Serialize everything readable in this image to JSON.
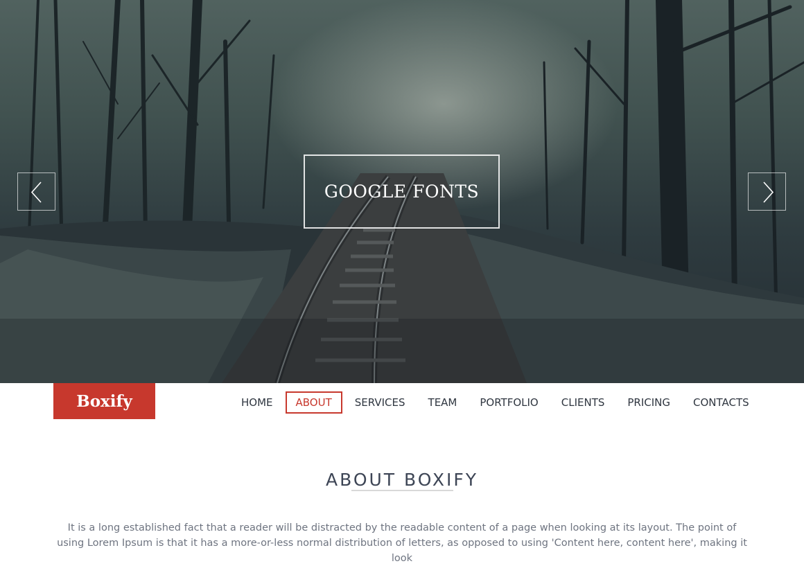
{
  "hero": {
    "caption": "GOOGLE FONTS",
    "prev_icon": "chevron-left-icon",
    "next_icon": "chevron-right-icon"
  },
  "navbar": {
    "logo": "Boxify",
    "items": [
      {
        "label": "HOME"
      },
      {
        "label": "ABOUT",
        "active": true
      },
      {
        "label": "SERVICES"
      },
      {
        "label": "TEAM"
      },
      {
        "label": "PORTFOLIO"
      },
      {
        "label": "CLIENTS"
      },
      {
        "label": "PRICING"
      },
      {
        "label": "CONTACTS"
      }
    ]
  },
  "about": {
    "title": "ABOUT BOXIFY",
    "text": "It is a long established fact that a reader will be distracted by the readable content of a page when looking at its layout. The point of using Lorem Ipsum is that it has a more-or-less normal distribution of letters, as opposed to using 'Content here, content here', making it look"
  },
  "colors": {
    "accent": "#c7382d",
    "text_dark": "#2f3640",
    "text_muted": "#6e7480"
  }
}
